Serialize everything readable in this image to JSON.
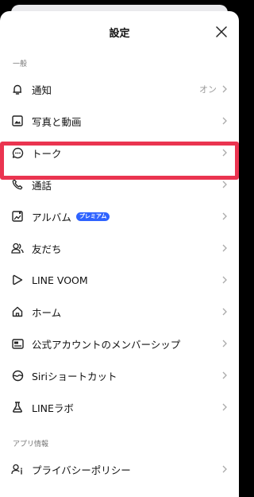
{
  "header": {
    "title": "設定"
  },
  "sections": [
    {
      "label": "一般",
      "items": [
        {
          "label": "通知",
          "value": "オン",
          "icon": "bell-icon"
        },
        {
          "label": "写真と動画",
          "icon": "photo-icon"
        },
        {
          "label": "トーク",
          "icon": "chat-bubble-icon",
          "highlighted": true
        },
        {
          "label": "通話",
          "icon": "phone-icon"
        },
        {
          "label": "アルバム",
          "badge": "プレミアム",
          "icon": "album-icon"
        },
        {
          "label": "友だち",
          "icon": "friends-icon"
        },
        {
          "label": "LINE VOOM",
          "icon": "voom-play-icon"
        },
        {
          "label": "ホーム",
          "icon": "home-icon"
        },
        {
          "label": "公式アカウントのメンバーシップ",
          "icon": "membership-card-icon"
        },
        {
          "label": "Siriショートカット",
          "icon": "siri-shortcut-icon"
        },
        {
          "label": "LINEラボ",
          "icon": "flask-icon"
        }
      ]
    },
    {
      "label": "アプリ情報",
      "items": [
        {
          "label": "プライバシーポリシー",
          "icon": "privacy-user-icon"
        }
      ]
    }
  ],
  "colors": {
    "highlight": "#ea3450",
    "badge": "#2f63ff",
    "accent": "#111111"
  }
}
